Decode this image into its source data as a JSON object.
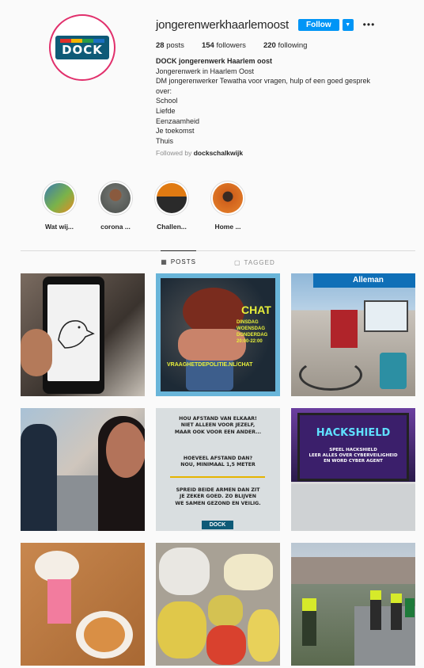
{
  "profile": {
    "username": "jongerenwerkhaarlemoost",
    "follow_label": "Follow",
    "avatar_text": "DOCK",
    "brand_colors": [
      "#0e5a77",
      "#e1306c",
      "#0095f6"
    ],
    "stats": {
      "posts_count": "28",
      "posts_label": "posts",
      "followers_count": "154",
      "followers_label": "followers",
      "following_count": "220",
      "following_label": "following"
    },
    "bio": {
      "name": "DOCK jongerenwerk Haarlem oost",
      "line1": "Jongerenwerk in Haarlem Oost",
      "line2": "DM jongerenwerker Tewatha voor vragen, hulp of een goed gesprek",
      "line3": "over:",
      "topics": [
        "School",
        "Liefde",
        "Eenzaamheid",
        "Je toekomst",
        "Thuis"
      ]
    },
    "followed_by_label": "Followed by",
    "followed_by_user": "dockschalkwijk"
  },
  "highlights": [
    {
      "label": "Wat wij...",
      "color": "#3a7bb0"
    },
    {
      "label": "corona ...",
      "color": "#6b6e6a"
    },
    {
      "label": "Challen...",
      "color": "#e07a12"
    },
    {
      "label": "Home ...",
      "color": "#d0611c"
    }
  ],
  "tabs": [
    {
      "label": "POSTS",
      "icon": "grid-icon"
    },
    {
      "label": "TAGGED",
      "icon": "tag-icon"
    }
  ],
  "posts": {
    "p2_title": "CHAT",
    "p2_lines": [
      "DINSDAG",
      "WOENSDAG",
      "DONDERDAG",
      "20:00-22:00"
    ],
    "p2_site": "VRAAGHETDEPOLITIE.NL/CHAT",
    "p3_store": "Alleman",
    "p5_text1": [
      "HOU AFSTAND VAN ELKAAR!",
      "NIET ALLEEN VOOR JEZELF,",
      "MAAR OOK VOOR EEN ANDER..."
    ],
    "p5_text2": [
      "HOEVEEL AFSTAND DAN?",
      "NOU, MINIMAAL 1,5 METER"
    ],
    "p5_text3": [
      "SPREID BEIDE ARMEN DAN ZIT",
      "JE ZEKER GOED. ZO BLIJVEN",
      "WE SAMEN GEZOND EN VEILIG."
    ],
    "p5_badge": "DOCK",
    "p6_title": "HACKSHIELD",
    "p6_sub": [
      "SPEEL HACKSHIELD",
      "LEER ALLES OVER CYBERVEILIGHEID",
      "EN WORD CYBER AGENT"
    ]
  }
}
